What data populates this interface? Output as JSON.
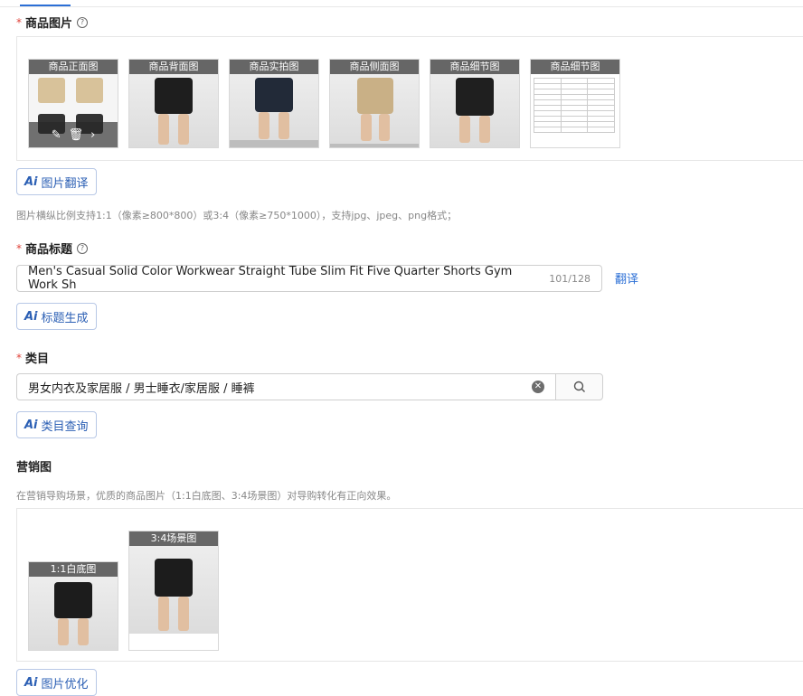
{
  "product_images": {
    "label": "商品图片",
    "thumbs": [
      {
        "label": "商品正面图"
      },
      {
        "label": "商品背面图"
      },
      {
        "label": "商品实拍图"
      },
      {
        "label": "商品侧面图"
      },
      {
        "label": "商品细节图"
      },
      {
        "label": "商品细节图"
      }
    ],
    "translate_button": "图片翻译",
    "hint": "图片横纵比例支持1:1（像素≥800*800）或3:4（像素≥750*1000），支持jpg、jpeg、png格式；"
  },
  "title": {
    "label": "商品标题",
    "value": "Men's Casual Solid Color Workwear Straight Tube Slim Fit Five Quarter Shorts Gym Work Sh",
    "counter": "101/128",
    "translate_link": "翻译",
    "ai_button": "标题生成"
  },
  "category": {
    "label": "类目",
    "value": "男女内衣及家居服 / 男士睡衣/家居服 / 睡裤",
    "ai_button": "类目查询"
  },
  "marketing": {
    "label": "营销图",
    "hint": "在营销导购场景，优质的商品图片（1:1白底图、3:4场景图）对导购转化有正向效果。",
    "thumbs": [
      {
        "label": "1:1白底图"
      },
      {
        "label": "3:4场景图"
      }
    ],
    "ai_button": "图片优化"
  },
  "ai_mark": "Ai",
  "colors": {
    "accent": "#2b6fd6",
    "required": "#e0443b",
    "ai_border": "#b8c8e6"
  }
}
